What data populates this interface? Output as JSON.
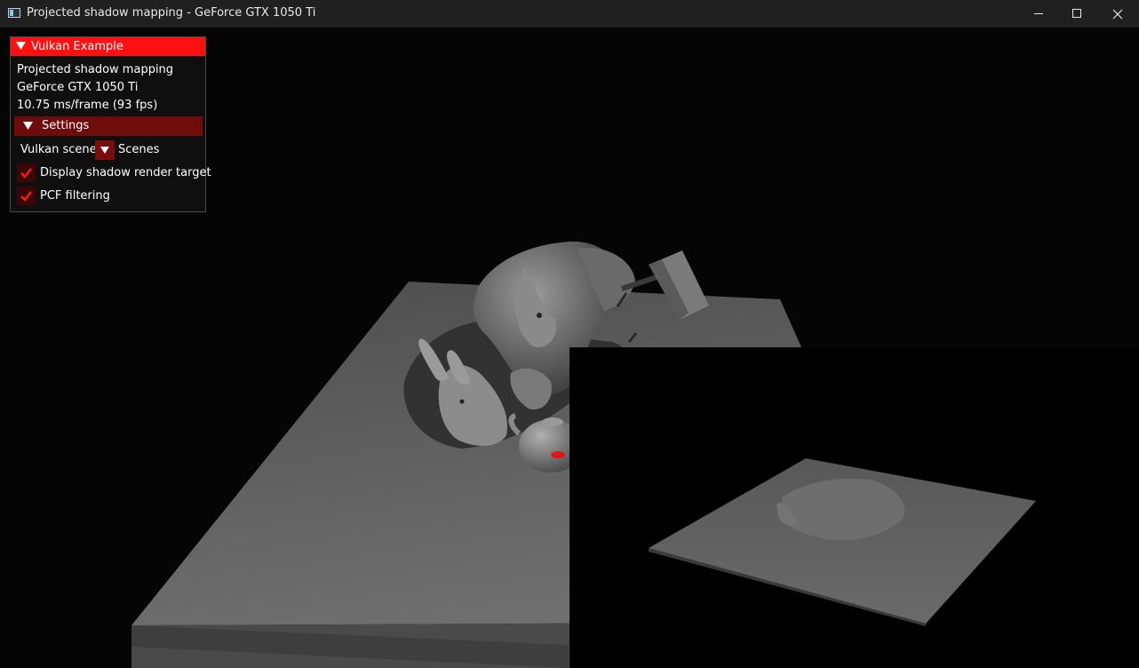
{
  "window": {
    "title": "Projected shadow mapping - GeForce GTX 1050 Ti",
    "icon": "app-window-icon"
  },
  "window_controls": {
    "minimize_icon": "minimize-icon",
    "maximize_icon": "maximize-icon",
    "close_icon": "close-icon"
  },
  "overlay": {
    "header_title": "Vulkan Example",
    "header_color": "#ff1010",
    "info": {
      "app_name": "Projected shadow mapping",
      "gpu_name": "GeForce GTX 1050 Ti",
      "frame_stats": "10.75 ms/frame (93 fps)"
    },
    "settings": {
      "header_label": "Settings",
      "header_color": "#6e0b0b",
      "scene_combo": {
        "selected": "Vulkan scene",
        "label": "Scenes"
      },
      "checkboxes": [
        {
          "label": "Display shadow render target",
          "checked": true
        },
        {
          "label": "PCF filtering",
          "checked": true
        }
      ]
    }
  },
  "scene": {
    "description_icon": "3d-render-scene",
    "shadow_map_preview": "shadow-render-target-preview"
  }
}
